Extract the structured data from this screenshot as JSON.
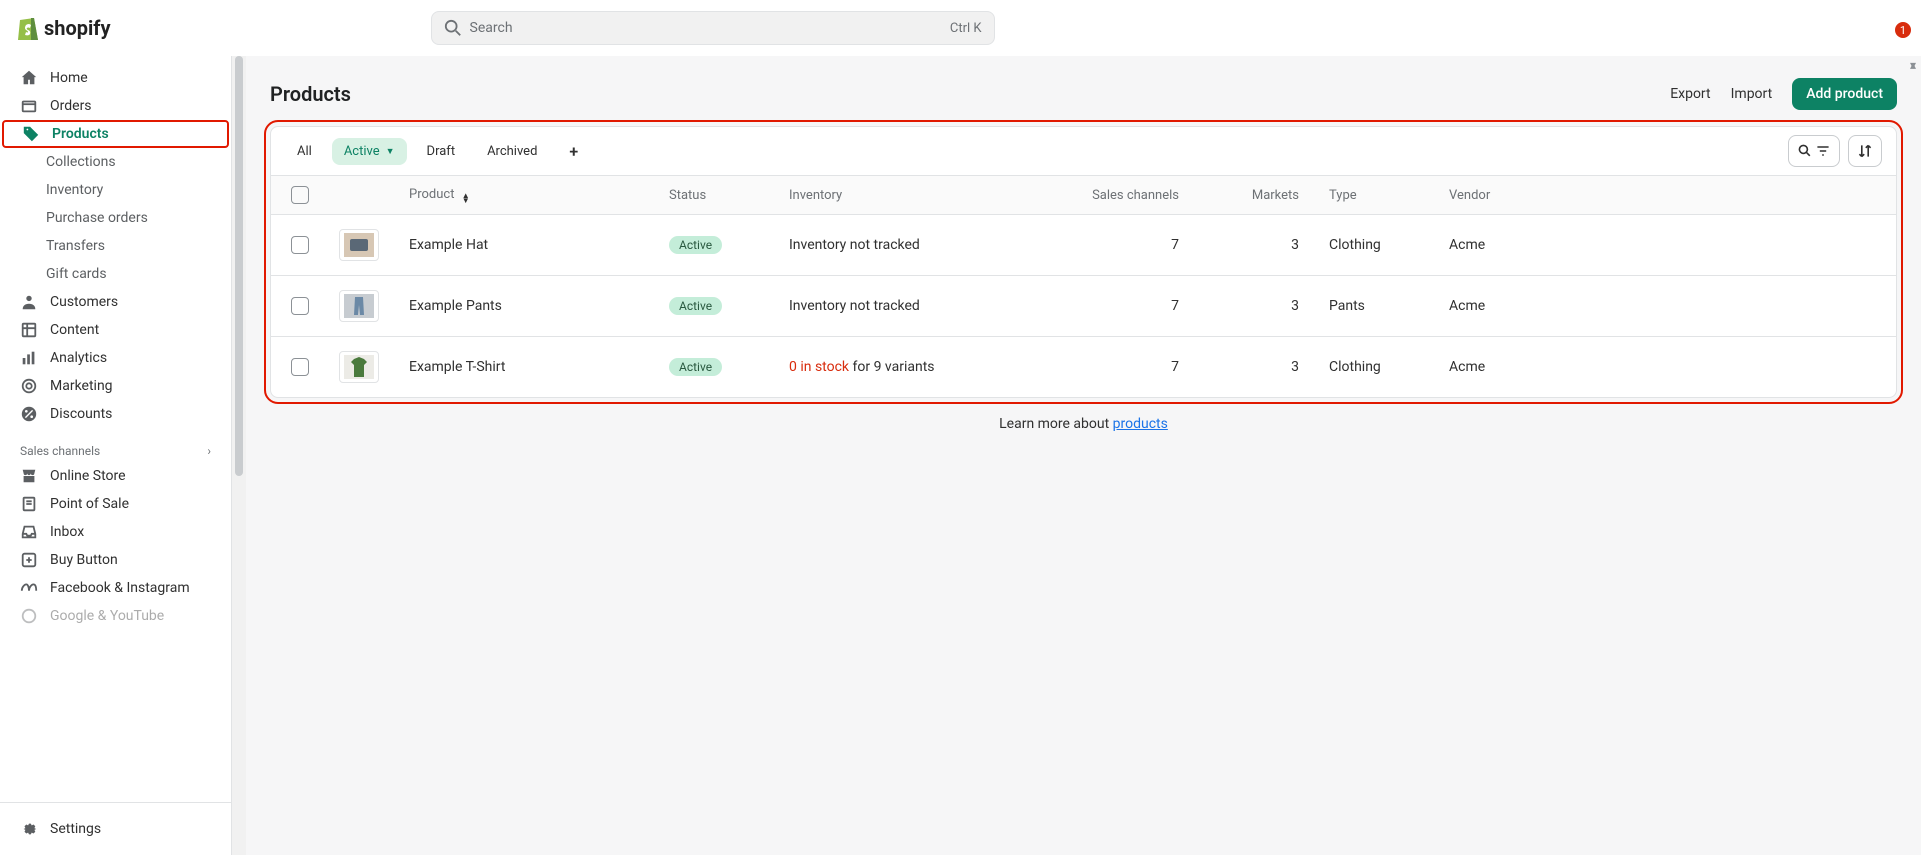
{
  "brand": "shopify",
  "search": {
    "placeholder": "Search",
    "kbd": "Ctrl K"
  },
  "notifications": {
    "count": "1"
  },
  "nav": {
    "home": "Home",
    "orders": "Orders",
    "products": "Products",
    "subs": [
      "Collections",
      "Inventory",
      "Purchase orders",
      "Transfers",
      "Gift cards"
    ],
    "customers": "Customers",
    "content": "Content",
    "analytics": "Analytics",
    "marketing": "Marketing",
    "discounts": "Discounts",
    "section_channels": "Sales channels",
    "online_store": "Online Store",
    "pos": "Point of Sale",
    "inbox": "Inbox",
    "buy_button": "Buy Button",
    "fb": "Facebook & Instagram",
    "gyt": "Google & YouTube",
    "settings": "Settings"
  },
  "page": {
    "title": "Products",
    "export": "Export",
    "import": "Import",
    "add": "Add product"
  },
  "tabs": {
    "all": "All",
    "active": "Active",
    "draft": "Draft",
    "archived": "Archived"
  },
  "columns": {
    "product": "Product",
    "status": "Status",
    "inventory": "Inventory",
    "sales": "Sales channels",
    "markets": "Markets",
    "type": "Type",
    "vendor": "Vendor"
  },
  "rows": [
    {
      "name": "Example Hat",
      "status": "Active",
      "inv_plain": "Inventory not tracked",
      "inv_red": "",
      "sales": "7",
      "markets": "3",
      "type": "Clothing",
      "vendor": "Acme",
      "thumb_bg": "#d7c7b4",
      "thumb_fg": "#5a6876",
      "shape": "box"
    },
    {
      "name": "Example Pants",
      "status": "Active",
      "inv_plain": "Inventory not tracked",
      "inv_red": "",
      "sales": "7",
      "markets": "3",
      "type": "Pants",
      "vendor": "Acme",
      "thumb_bg": "#c7ccd1",
      "thumb_fg": "#6b89a6",
      "shape": "pants"
    },
    {
      "name": "Example T-Shirt",
      "status": "Active",
      "inv_plain": " for 9 variants",
      "inv_red": "0 in stock",
      "sales": "7",
      "markets": "3",
      "type": "Clothing",
      "vendor": "Acme",
      "thumb_bg": "#ecebe6",
      "thumb_fg": "#4a7a3d",
      "shape": "shirt"
    }
  ],
  "learn": {
    "text": "Learn more about ",
    "link": "products"
  }
}
